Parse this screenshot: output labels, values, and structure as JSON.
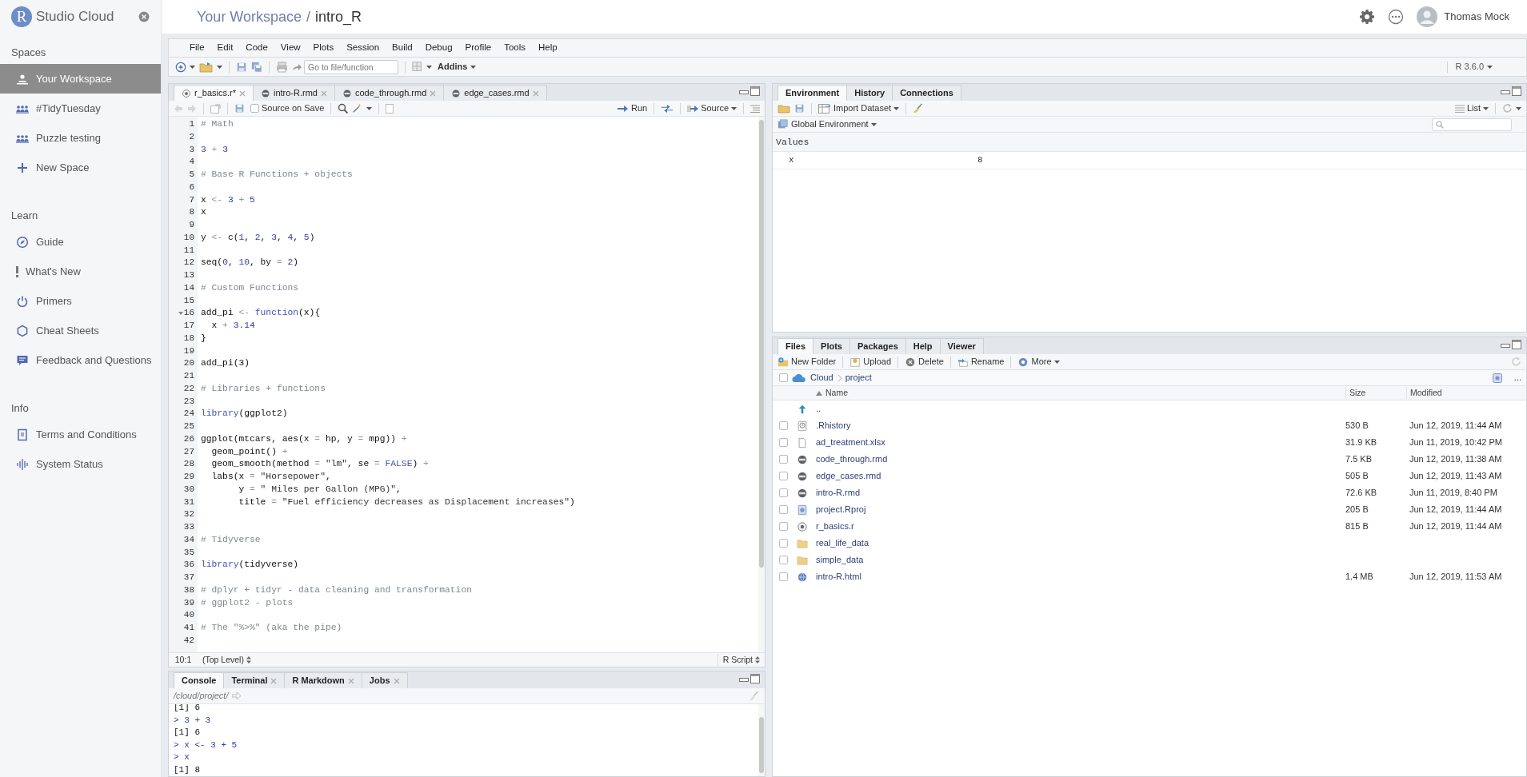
{
  "sidebar": {
    "brand_letter": "R",
    "brand": "Studio Cloud",
    "sections": [
      {
        "heading": "Spaces",
        "items": [
          {
            "label": "Your Workspace",
            "kind": "workspace",
            "selected": true
          },
          {
            "label": "#TidyTuesday",
            "kind": "people",
            "selected": false
          },
          {
            "label": "Puzzle testing",
            "kind": "people",
            "selected": false
          },
          {
            "label": "New Space",
            "kind": "plus",
            "selected": false
          }
        ]
      },
      {
        "heading": "Learn",
        "items": [
          {
            "label": "Guide",
            "kind": "compass",
            "selected": false
          },
          {
            "label": "What's New",
            "kind": "exclaim",
            "selected": false
          },
          {
            "label": "Primers",
            "kind": "power",
            "selected": false
          },
          {
            "label": "Cheat Sheets",
            "kind": "hexagon",
            "selected": false
          },
          {
            "label": "Feedback and Questions",
            "kind": "chat",
            "selected": false
          }
        ]
      },
      {
        "heading": "Info",
        "items": [
          {
            "label": "Terms and Conditions",
            "kind": "document",
            "selected": false
          },
          {
            "label": "System Status",
            "kind": "pulse",
            "selected": false
          }
        ]
      }
    ]
  },
  "header": {
    "workspace": "Your Workspace",
    "separator": "/",
    "project": "intro_R",
    "user": "Thomas Mock"
  },
  "menu": [
    "File",
    "Edit",
    "Code",
    "View",
    "Plots",
    "Session",
    "Build",
    "Debug",
    "Profile",
    "Tools",
    "Help"
  ],
  "toolbar": {
    "goto_placeholder": "Go to file/function",
    "addins": "Addins",
    "r_version": "R 3.6.0"
  },
  "editor": {
    "tabs": [
      {
        "label": "r_basics.r*",
        "kind": "r",
        "selected": true
      },
      {
        "label": "intro-R.rmd",
        "kind": "rmd",
        "selected": false
      },
      {
        "label": "code_through.rmd",
        "kind": "rmd",
        "selected": false
      },
      {
        "label": "edge_cases.rmd",
        "kind": "rmd",
        "selected": false
      }
    ],
    "source_on_save": {
      "label": "Source on Save",
      "checked": false
    },
    "run": "Run",
    "source": "Source",
    "lines": [
      {
        "n": "1",
        "segs": [
          {
            "kind": "comment",
            "text": "# Math"
          }
        ]
      },
      {
        "n": "2"
      },
      {
        "n": "3",
        "segs": [
          {
            "kind": "number",
            "text": "3"
          },
          {
            "kind": "operator",
            "text": " + "
          },
          {
            "kind": "number",
            "text": "3"
          }
        ]
      },
      {
        "n": "4"
      },
      {
        "n": "5",
        "segs": [
          {
            "kind": "comment",
            "text": "# Base R Functions + objects"
          }
        ]
      },
      {
        "n": "6"
      },
      {
        "n": "7",
        "segs": [
          {
            "kind": "plain",
            "text": "x"
          },
          {
            "kind": "operator",
            "text": " <- "
          },
          {
            "kind": "number",
            "text": "3"
          },
          {
            "kind": "operator",
            "text": " + "
          },
          {
            "kind": "number",
            "text": "5"
          }
        ]
      },
      {
        "n": "8",
        "segs": [
          {
            "kind": "plain",
            "text": "x"
          }
        ]
      },
      {
        "n": "9"
      },
      {
        "n": "10",
        "segs": [
          {
            "kind": "plain",
            "text": "y"
          },
          {
            "kind": "operator",
            "text": " <- "
          },
          {
            "kind": "plain",
            "text": "c("
          },
          {
            "kind": "number",
            "text": "1"
          },
          {
            "kind": "plain",
            "text": ", "
          },
          {
            "kind": "number",
            "text": "2"
          },
          {
            "kind": "plain",
            "text": ", "
          },
          {
            "kind": "number",
            "text": "3"
          },
          {
            "kind": "plain",
            "text": ", "
          },
          {
            "kind": "number",
            "text": "4"
          },
          {
            "kind": "plain",
            "text": ", "
          },
          {
            "kind": "number",
            "text": "5"
          },
          {
            "kind": "plain",
            "text": ")"
          }
        ]
      },
      {
        "n": "11"
      },
      {
        "n": "12",
        "segs": [
          {
            "kind": "plain",
            "text": "seq("
          },
          {
            "kind": "number",
            "text": "0"
          },
          {
            "kind": "plain",
            "text": ", "
          },
          {
            "kind": "number",
            "text": "10"
          },
          {
            "kind": "plain",
            "text": ", by"
          },
          {
            "kind": "operator",
            "text": " = "
          },
          {
            "kind": "number",
            "text": "2"
          },
          {
            "kind": "plain",
            "text": ")"
          }
        ]
      },
      {
        "n": "13"
      },
      {
        "n": "14",
        "segs": [
          {
            "kind": "comment",
            "text": "# Custom Functions"
          }
        ]
      },
      {
        "n": "15"
      },
      {
        "n": "16",
        "fold": true,
        "segs": [
          {
            "kind": "plain",
            "text": "add_pi"
          },
          {
            "kind": "operator",
            "text": " <- "
          },
          {
            "kind": "keyword",
            "text": "function"
          },
          {
            "kind": "plain",
            "text": "(x){"
          }
        ]
      },
      {
        "n": "17",
        "segs": [
          {
            "kind": "plain",
            "text": "  x"
          },
          {
            "kind": "operator",
            "text": " + "
          },
          {
            "kind": "number",
            "text": "3.14"
          }
        ]
      },
      {
        "n": "18",
        "segs": [
          {
            "kind": "plain",
            "text": "}"
          }
        ]
      },
      {
        "n": "19"
      },
      {
        "n": "20",
        "segs": [
          {
            "kind": "plain",
            "text": "add_pi(3)"
          }
        ]
      },
      {
        "n": "21"
      },
      {
        "n": "22",
        "segs": [
          {
            "kind": "comment",
            "text": "# Libraries + functions"
          }
        ]
      },
      {
        "n": "23"
      },
      {
        "n": "24",
        "segs": [
          {
            "kind": "keyword",
            "text": "library"
          },
          {
            "kind": "plain",
            "text": "(ggplot2)"
          }
        ]
      },
      {
        "n": "25"
      },
      {
        "n": "26",
        "segs": [
          {
            "kind": "plain",
            "text": "ggplot(mtcars, aes(x"
          },
          {
            "kind": "operator",
            "text": " = "
          },
          {
            "kind": "plain",
            "text": "hp, y"
          },
          {
            "kind": "operator",
            "text": " = "
          },
          {
            "kind": "plain",
            "text": "mpg))"
          },
          {
            "kind": "operator",
            "text": " +"
          }
        ]
      },
      {
        "n": "27",
        "segs": [
          {
            "kind": "plain",
            "text": "  geom_point()"
          },
          {
            "kind": "operator",
            "text": " +"
          }
        ]
      },
      {
        "n": "28",
        "segs": [
          {
            "kind": "plain",
            "text": "  geom_smooth(method"
          },
          {
            "kind": "operator",
            "text": " = "
          },
          {
            "kind": "string",
            "text": "\"lm\""
          },
          {
            "kind": "plain",
            "text": ", se"
          },
          {
            "kind": "operator",
            "text": " = "
          },
          {
            "kind": "keyword",
            "text": "FALSE"
          },
          {
            "kind": "plain",
            "text": ")"
          },
          {
            "kind": "operator",
            "text": " +"
          }
        ]
      },
      {
        "n": "29",
        "segs": [
          {
            "kind": "plain",
            "text": "  labs(x"
          },
          {
            "kind": "operator",
            "text": " = "
          },
          {
            "kind": "string",
            "text": "\"Horsepower\""
          },
          {
            "kind": "plain",
            "text": ","
          }
        ]
      },
      {
        "n": "30",
        "segs": [
          {
            "kind": "plain",
            "text": "       y"
          },
          {
            "kind": "operator",
            "text": " = "
          },
          {
            "kind": "string",
            "text": "\" Miles per Gallon (MPG)\""
          },
          {
            "kind": "plain",
            "text": ","
          }
        ]
      },
      {
        "n": "31",
        "segs": [
          {
            "kind": "plain",
            "text": "       title"
          },
          {
            "kind": "operator",
            "text": " = "
          },
          {
            "kind": "string",
            "text": "\"Fuel efficiency decreases as Displacement increases\""
          },
          {
            "kind": "plain",
            "text": ")"
          }
        ]
      },
      {
        "n": "32"
      },
      {
        "n": "33"
      },
      {
        "n": "34",
        "segs": [
          {
            "kind": "comment",
            "text": "# Tidyverse"
          }
        ]
      },
      {
        "n": "35"
      },
      {
        "n": "36",
        "segs": [
          {
            "kind": "keyword",
            "text": "library"
          },
          {
            "kind": "plain",
            "text": "(tidyverse)"
          }
        ]
      },
      {
        "n": "37"
      },
      {
        "n": "38",
        "segs": [
          {
            "kind": "comment",
            "text": "# dplyr + tidyr - data cleaning and transformation"
          }
        ]
      },
      {
        "n": "39",
        "segs": [
          {
            "kind": "comment",
            "text": "# ggplot2 - plots"
          }
        ]
      },
      {
        "n": "40"
      },
      {
        "n": "41",
        "segs": [
          {
            "kind": "comment",
            "text": "# The \"%>%\" (aka the pipe)"
          }
        ]
      },
      {
        "n": "42"
      }
    ],
    "status": {
      "position": "10:1",
      "scope": "(Top Level)",
      "file_type": "R Script"
    }
  },
  "console": {
    "tabs": [
      {
        "label": "Console",
        "selected": true,
        "closable": false
      },
      {
        "label": "Terminal",
        "selected": false,
        "closable": true
      },
      {
        "label": "R Markdown",
        "selected": false,
        "closable": true
      },
      {
        "label": "Jobs",
        "selected": false,
        "closable": true
      }
    ],
    "path": "/cloud/project/",
    "lines": [
      {
        "kind": "output",
        "text": "[1] 6"
      },
      {
        "kind": "input",
        "text": "> 3 + 3"
      },
      {
        "kind": "output",
        "text": "[1] 6"
      },
      {
        "kind": "input",
        "text": "> x <- 3 + 5"
      },
      {
        "kind": "input",
        "text": "> x"
      },
      {
        "kind": "output",
        "text": "[1] 8"
      }
    ]
  },
  "environment": {
    "tabs": [
      {
        "label": "Environment",
        "selected": true
      },
      {
        "label": "History",
        "selected": false
      },
      {
        "label": "Connections",
        "selected": false
      }
    ],
    "import": "Import Dataset",
    "view": "List",
    "scope": "Global Environment",
    "section": "Values",
    "variables": [
      {
        "name": "x",
        "value": "8"
      }
    ]
  },
  "files": {
    "tabs": [
      {
        "label": "Files",
        "selected": true
      },
      {
        "label": "Plots",
        "selected": false
      },
      {
        "label": "Packages",
        "selected": false
      },
      {
        "label": "Help",
        "selected": false
      },
      {
        "label": "Viewer",
        "selected": false
      }
    ],
    "actions": [
      {
        "label": "New Folder",
        "kind": "new-folder"
      },
      {
        "label": "Upload",
        "kind": "upload"
      },
      {
        "label": "Delete",
        "kind": "delete"
      },
      {
        "label": "Rename",
        "kind": "rename"
      },
      {
        "label": "More",
        "kind": "more"
      }
    ],
    "breadcrumb": [
      "Cloud",
      "project"
    ],
    "path_menu": "...",
    "all_checked": false,
    "columns": [
      "Name",
      "Size",
      "Modified"
    ],
    "rows": [
      {
        "name": "..",
        "kind": "up"
      },
      {
        "name": ".Rhistory",
        "kind": "history",
        "size": "530 B",
        "modified": "Jun 12, 2019, 11:44 AM",
        "checked": false
      },
      {
        "name": "ad_treatment.xlsx",
        "kind": "doc",
        "size": "31.9 KB",
        "modified": "Jun 11, 2019, 10:42 PM",
        "checked": false
      },
      {
        "name": "code_through.rmd",
        "kind": "rmd",
        "size": "7.5 KB",
        "modified": "Jun 12, 2019, 11:38 AM",
        "checked": false
      },
      {
        "name": "edge_cases.rmd",
        "kind": "rmd",
        "size": "505 B",
        "modified": "Jun 12, 2019, 11:43 AM",
        "checked": false
      },
      {
        "name": "intro-R.rmd",
        "kind": "rmd",
        "size": "72.6 KB",
        "modified": "Jun 11, 2019, 8:40 PM",
        "checked": false
      },
      {
        "name": "project.Rproj",
        "kind": "rproj",
        "size": "205 B",
        "modified": "Jun 12, 2019, 11:44 AM",
        "checked": false
      },
      {
        "name": "r_basics.r",
        "kind": "r",
        "size": "815 B",
        "modified": "Jun 12, 2019, 11:44 AM",
        "checked": false
      },
      {
        "name": "real_life_data",
        "kind": "folder",
        "checked": false
      },
      {
        "name": "simple_data",
        "kind": "folder",
        "checked": false
      },
      {
        "name": "intro-R.html",
        "kind": "html",
        "size": "1.4 MB",
        "modified": "Jun 12, 2019, 11:53 AM",
        "checked": false
      }
    ]
  }
}
